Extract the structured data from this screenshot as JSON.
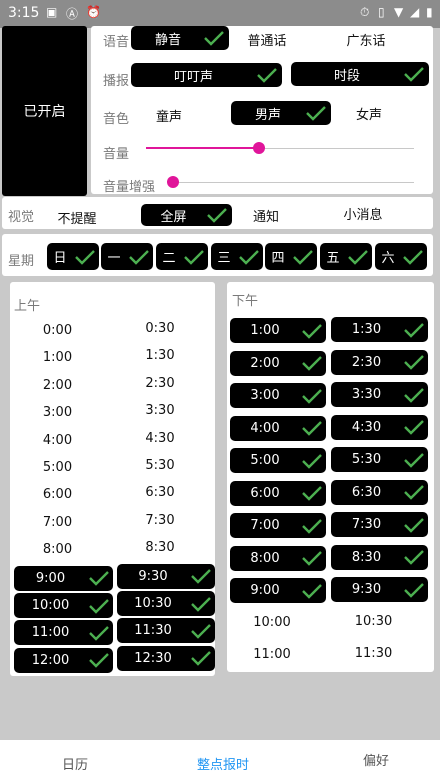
{
  "status": {
    "time": "3:15"
  },
  "switch_label": "已开启",
  "voice": {
    "label": "语音",
    "options": [
      "静音",
      "普通话",
      "广东话"
    ]
  },
  "broadcast": {
    "label": "播报",
    "options": [
      "叮叮声",
      "时段"
    ]
  },
  "timbre": {
    "label": "音色",
    "options": [
      "童声",
      "男声",
      "女声"
    ]
  },
  "volume": {
    "label": "音量",
    "level": 0.42
  },
  "boost": {
    "label": "音量增强",
    "level": 0.0
  },
  "visual": {
    "label": "视觉",
    "options": [
      "不提醒",
      "全屏",
      "通知",
      "小消息"
    ]
  },
  "week": {
    "label": "星期",
    "days": [
      "日",
      "一",
      "二",
      "三",
      "四",
      "五",
      "六"
    ]
  },
  "am": {
    "label": "上午",
    "col1": [
      "0:00",
      "1:00",
      "2:00",
      "3:00",
      "4:00",
      "5:00",
      "6:00",
      "7:00",
      "8:00",
      "9:00",
      "10:00",
      "11:00",
      "12:00"
    ],
    "col2": [
      "0:30",
      "1:30",
      "2:30",
      "3:30",
      "4:30",
      "5:30",
      "6:30",
      "7:30",
      "8:30",
      "9:30",
      "10:30",
      "11:30",
      "12:30"
    ]
  },
  "pm": {
    "label": "下午",
    "col1": [
      "1:00",
      "2:00",
      "3:00",
      "4:00",
      "5:00",
      "6:00",
      "7:00",
      "8:00",
      "9:00",
      "10:00",
      "11:00"
    ],
    "col2": [
      "1:30",
      "2:30",
      "3:30",
      "4:30",
      "5:30",
      "6:30",
      "7:30",
      "8:30",
      "9:30",
      "10:30",
      "11:30"
    ]
  },
  "nav": {
    "items": [
      "日历",
      "整点报时",
      "偏好"
    ],
    "active_color": "#2196f3"
  },
  "colors": {
    "accent": "#e0159a",
    "check": "#4caf50"
  }
}
